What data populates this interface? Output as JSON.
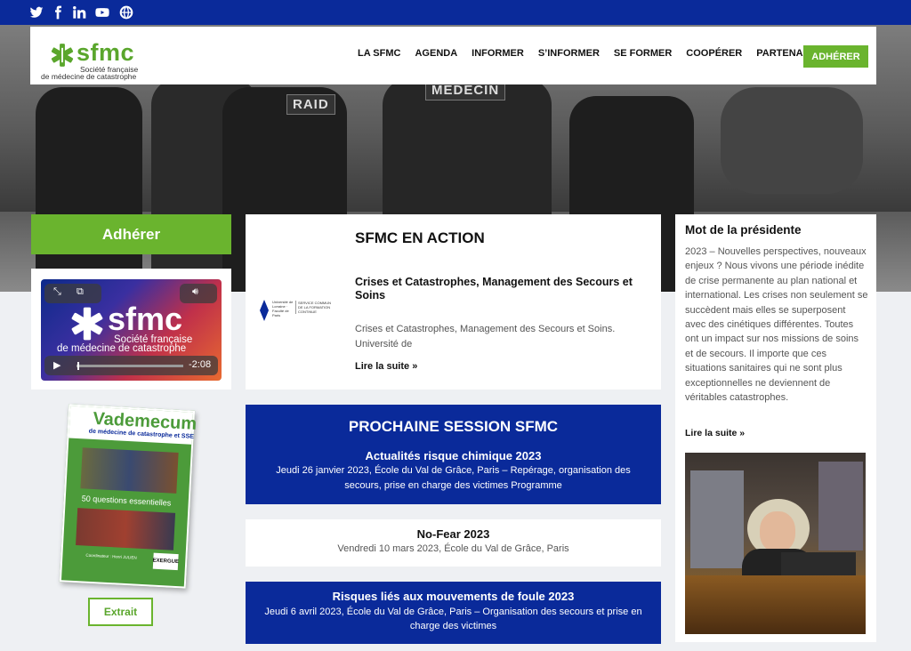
{
  "social": {
    "twitter": "twitter-icon",
    "facebook": "facebook-icon",
    "linkedin": "linkedin-icon",
    "youtube": "youtube-icon",
    "web": "globe-icon"
  },
  "header": {
    "logo_name": "sfmc",
    "logo_sub1": "Société française",
    "logo_sub2": "de médecine de catastrophe",
    "nav": [
      "LA SFMC",
      "AGENDA",
      "INFORMER",
      "S’INFORMER",
      "SE FORMER",
      "COOPÉRER",
      "PARTENARIAT"
    ],
    "cta": "ADHÉRER"
  },
  "hero": {
    "patch1": "MEDECIN",
    "patch2": "RAID"
  },
  "left": {
    "adherer": "Adhérer",
    "video": {
      "name": "sfmc",
      "sub1": "Société française",
      "sub2": "de médecine de catastrophe",
      "time": "-2:08",
      "progress": 0.01
    },
    "book": {
      "title": "Vademecum",
      "subtitle": "de médecine de catastrophe et SSE",
      "questions": "50 questions essentielles",
      "coordination": "Coordinateur : Henri JULIEN",
      "badge": "EXERGUE"
    },
    "extrait": "Extrait"
  },
  "action": {
    "title": "SFMC EN ACTION",
    "article_title": "Crises et Catastrophes, Management des Secours et Soins",
    "excerpt": "Crises et Catastrophes, Management des Secours et Soins. Université de",
    "more": "Lire la suite »",
    "logo_left": "Université de Lorraine · Faculté de Paris",
    "logo_right": "SERVICE COMMUN DE LA FORMATION CONTINUE"
  },
  "session": {
    "heading": "PROCHAINE SESSION SFMC",
    "title": "Actualités risque chimique 2023",
    "desc": "Jeudi 26 janvier 2023, École du Val de Grâce, Paris – Repérage, organisation des secours, prise en charge des victimes Programme"
  },
  "nofear": {
    "title": "No-Fear 2023",
    "desc": "Vendredi 10 mars 2023, École du Val de Grâce, Paris"
  },
  "foule": {
    "title": "Risques liés aux mouvements de foule 2023",
    "desc": "Jeudi 6 avril 2023, École du Val de Grâce, Paris – Organisation des secours et prise en charge des victimes"
  },
  "president": {
    "title": "Mot de la présidente",
    "text": "2023 – Nouvelles perspectives, nouveaux enjeux ? Nous vivons une période inédite de crise permanente au plan national et international. Les crises non seulement se succèdent mais elles se superposent avec des cinétiques différentes. Toutes ont un impact sur nos missions de soins et de secours. Il importe que ces situations sanitaires qui ne sont plus exceptionnelles ne deviennent de véritables catastrophes.",
    "more": "Lire la suite »"
  },
  "colors": {
    "brand_blue": "#0a2a9a",
    "brand_green": "#6ab42e"
  }
}
